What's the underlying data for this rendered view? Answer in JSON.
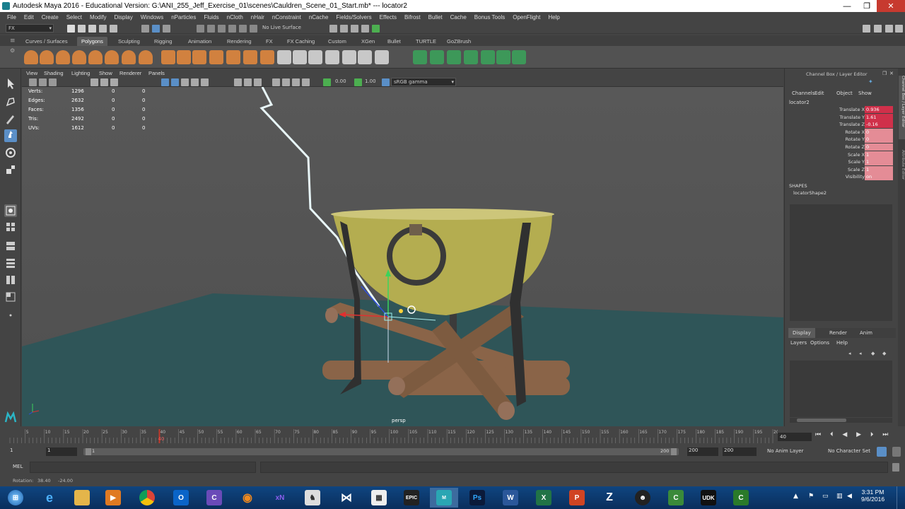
{
  "window": {
    "title": "Autodesk Maya 2016 - Educational Version: G:\\ANI_255_Jeff_Exercise_01\\scenes\\Cauldren_Scene_01_Start.mb*  ---  locator2",
    "controls": [
      "—",
      "❐",
      "✕"
    ]
  },
  "menubar": [
    "File",
    "Edit",
    "Create",
    "Select",
    "Modify",
    "Display",
    "Windows",
    "nParticles",
    "Fluids",
    "nCloth",
    "nHair",
    "nConstraint",
    "nCache",
    "Fields/Solvers",
    "Effects",
    "Bifrost",
    "Bullet",
    "Cache",
    "Bonus Tools",
    "OpenFlight",
    "Help"
  ],
  "statusline": {
    "menuset": "FX",
    "live_surface": "No Live Surface"
  },
  "shelf_tabs": [
    {
      "label": "Curves / Surfaces",
      "active": false
    },
    {
      "label": "Polygons",
      "active": true
    },
    {
      "label": "Sculpting",
      "active": false
    },
    {
      "label": "Rigging",
      "active": false
    },
    {
      "label": "Animation",
      "active": false
    },
    {
      "label": "Rendering",
      "active": false
    },
    {
      "label": "FX",
      "active": false
    },
    {
      "label": "FX Caching",
      "active": false
    },
    {
      "label": "Custom",
      "active": false
    },
    {
      "label": "XGen",
      "active": false
    },
    {
      "label": "Bullet",
      "active": false
    },
    {
      "label": "TURTLE",
      "active": false
    },
    {
      "label": "GoZBrush",
      "active": false
    }
  ],
  "viewport": {
    "menus": [
      "View",
      "Shading",
      "Lighting",
      "Show",
      "Renderer",
      "Panels"
    ],
    "gamma_value": "0.00",
    "exposure_value": "1.00",
    "color_space": "sRGB gamma",
    "camera_label": "persp",
    "hud": [
      {
        "label": "Verts:",
        "v1": "1296",
        "v2": "0",
        "v3": "0"
      },
      {
        "label": "Edges:",
        "v1": "2632",
        "v2": "0",
        "v3": "0"
      },
      {
        "label": "Faces:",
        "v1": "1356",
        "v2": "0",
        "v3": "0"
      },
      {
        "label": "Tris:",
        "v1": "2492",
        "v2": "0",
        "v3": "0"
      },
      {
        "label": "UVs:",
        "v1": "1612",
        "v2": "0",
        "v3": "0"
      }
    ]
  },
  "channel_box": {
    "header": "Channel Box / Layer Editor",
    "menus": [
      "Channels",
      "Edit",
      "Object",
      "Show"
    ],
    "object_name": "locator2",
    "channels": [
      {
        "label": "Translate X",
        "value": "0.936"
      },
      {
        "label": "Translate Y",
        "value": "1.61"
      },
      {
        "label": "Translate Z",
        "value": "-0.16"
      },
      {
        "label": "Rotate X",
        "value": "0"
      },
      {
        "label": "Rotate Y",
        "value": "0"
      },
      {
        "label": "Rotate Z",
        "value": "0"
      },
      {
        "label": "Scale X",
        "value": "1"
      },
      {
        "label": "Scale Y",
        "value": "1"
      },
      {
        "label": "Scale Z",
        "value": "1"
      },
      {
        "label": "Visibility",
        "value": "on"
      }
    ],
    "shapes_label": "SHAPES",
    "shape_name": "locatorShape2",
    "layer_tabs": [
      "Display",
      "Render",
      "Anim"
    ],
    "layer_menus": [
      "Layers",
      "Options",
      "Help"
    ],
    "side_tabs": [
      "Channel Box / Layer Editor",
      "Attribute Editor"
    ]
  },
  "timeline": {
    "ticks": [
      "5",
      "10",
      "15",
      "20",
      "25",
      "30",
      "35",
      "40",
      "45",
      "50",
      "55",
      "60",
      "65",
      "70",
      "75",
      "80",
      "85",
      "90",
      "95",
      "100",
      "105",
      "110",
      "115",
      "120",
      "125",
      "130",
      "135",
      "140",
      "145",
      "150",
      "155",
      "160",
      "165",
      "170",
      "175",
      "180",
      "185",
      "190",
      "195",
      "200"
    ],
    "current_frame": "40",
    "current_frame_field": "40"
  },
  "range": {
    "start": "1",
    "start_inner": "1",
    "slider_start": "1",
    "slider_end": "200",
    "end_inner": "200",
    "end": "200",
    "anim_layer": "No Anim Layer",
    "character_set": "No Character Set"
  },
  "command_line": {
    "language": "MEL"
  },
  "help_line": {
    "label": "Rotation:",
    "v1": "38.40",
    "v2": "-24.00"
  },
  "taskbar": {
    "time": "3:31 PM",
    "date": "9/6/2016"
  }
}
